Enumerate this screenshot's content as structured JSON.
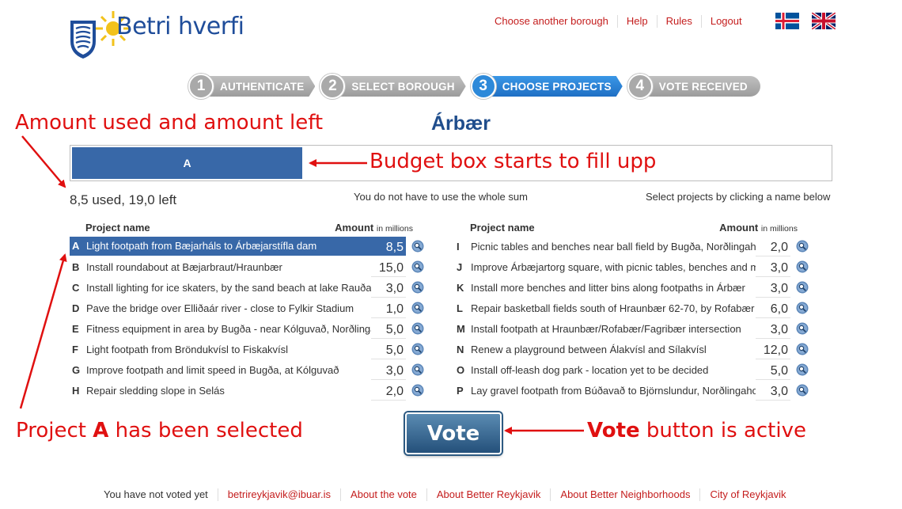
{
  "brand": {
    "name": "Betri hverfi"
  },
  "topnav": [
    {
      "label": "Choose another borough"
    },
    {
      "label": "Help"
    },
    {
      "label": "Rules"
    },
    {
      "label": "Logout"
    }
  ],
  "steps": [
    {
      "num": "1",
      "label": "AUTHENTICATE"
    },
    {
      "num": "2",
      "label": "SELECT BOROUGH"
    },
    {
      "num": "3",
      "label": "CHOOSE PROJECTS"
    },
    {
      "num": "4",
      "label": "VOTE RECEIVED"
    }
  ],
  "active_step": 3,
  "borough": "Árbær",
  "budget": {
    "fill_fraction": 0.304,
    "selected_letter": "A"
  },
  "summary": {
    "used_text": "8,5 used, 19,0 left",
    "hint_whole_sum": "You do not have to use the whole sum",
    "hint_select": "Select projects by clicking a name below"
  },
  "table_header": {
    "name": "Project name",
    "amount": "Amount",
    "unit": "in millions"
  },
  "projects_left": [
    {
      "letter": "A",
      "name": "Light footpath from Bæjarháls to Árbæjarstífla dam",
      "amount": "8,5",
      "selected": true
    },
    {
      "letter": "B",
      "name": "Install roundabout at Bæjarbraut/Hraunbær",
      "amount": "15,0",
      "selected": false
    },
    {
      "letter": "C",
      "name": "Install lighting for ice skaters, by the sand beach at lake Rauðavatn",
      "amount": "3,0",
      "selected": false
    },
    {
      "letter": "D",
      "name": "Pave the bridge over Elliðaár river - close to Fylkir Stadium",
      "amount": "1,0",
      "selected": false
    },
    {
      "letter": "E",
      "name": "Fitness equipment in area by Bugða - near Kólguvað, Norðlingaholt",
      "amount": "5,0",
      "selected": false
    },
    {
      "letter": "F",
      "name": "Light footpath from Bröndukvísl to Fiskakvísl",
      "amount": "5,0",
      "selected": false
    },
    {
      "letter": "G",
      "name": "Improve footpath and limit speed in Bugða, at Kólguvað",
      "amount": "3,0",
      "selected": false
    },
    {
      "letter": "H",
      "name": "Repair sledding slope in Selás",
      "amount": "2,0",
      "selected": false
    }
  ],
  "projects_right": [
    {
      "letter": "I",
      "name": "Picnic tables and benches near ball field by Bugða, Norðlingaholt",
      "amount": "2,0",
      "selected": false
    },
    {
      "letter": "J",
      "name": "Improve Árbæjartorg square, with picnic tables, benches and more",
      "amount": "3,0",
      "selected": false
    },
    {
      "letter": "K",
      "name": "Install more benches and litter bins along footpaths in Árbær",
      "amount": "3,0",
      "selected": false
    },
    {
      "letter": "L",
      "name": "Repair basketball fields south of Hraunbær 62-70, by Rofabær",
      "amount": "6,0",
      "selected": false
    },
    {
      "letter": "M",
      "name": "Install footpath at Hraunbær/Rofabær/Fagribær intersection",
      "amount": "3,0",
      "selected": false
    },
    {
      "letter": "N",
      "name": "Renew a playground between Álakvísl and Sílakvísl",
      "amount": "12,0",
      "selected": false
    },
    {
      "letter": "O",
      "name": "Install off-leash dog park - location yet to be decided",
      "amount": "5,0",
      "selected": false
    },
    {
      "letter": "P",
      "name": "Lay gravel footpath from Búðavað to Björnslundur, Norðlingaholt",
      "amount": "3,0",
      "selected": false
    }
  ],
  "vote_label": "Vote",
  "annotations": {
    "amount_used": "Amount used and amount left",
    "budget_box": "Budget box starts to fill upp",
    "project_selected_pre": "Project ",
    "project_selected_bold": "A",
    "project_selected_post": " has been selected",
    "vote_active_bold": "Vote",
    "vote_active_post": " button is active"
  },
  "footer": {
    "status": "You have not voted yet",
    "links": [
      {
        "label": "betrireykjavik@ibuar.is"
      },
      {
        "label": "About the vote"
      },
      {
        "label": "About Better Reykjavik"
      },
      {
        "label": "About Better Neighborhoods"
      },
      {
        "label": "City of Reykjavik"
      }
    ]
  },
  "colors": {
    "accent_red": "#c41d1d",
    "annotation_red": "#e01010",
    "selected_blue": "#3868a8",
    "title_blue": "#1f4d8c"
  },
  "icons": [
    "reykjavik-crest-icon",
    "sun-icon",
    "iceland-flag-icon",
    "uk-flag-icon",
    "magnifier-icon"
  ]
}
